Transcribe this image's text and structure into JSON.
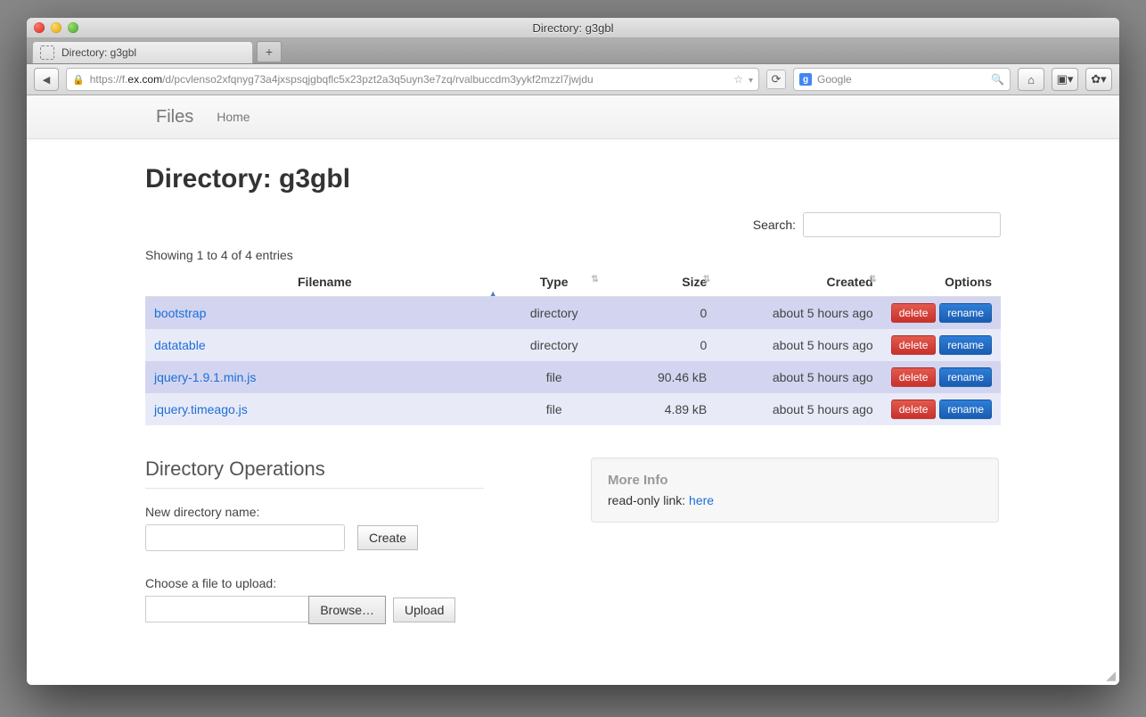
{
  "window": {
    "title": "Directory: g3gbl"
  },
  "tab": {
    "title": "Directory: g3gbl"
  },
  "url": {
    "scheme": "https://f.",
    "host": "ex.com",
    "path": "/d/pcvlenso2xfqnyg73a4jxspsqjgbqflc5x23pzt2a3q5uyn3e7zq/rvalbuccdm3yykf2mzzl7jwjdu"
  },
  "browser_search": {
    "engine_initial": "g",
    "placeholder": "Google"
  },
  "navbar": {
    "brand": "Files",
    "home": "Home"
  },
  "page_title": "Directory: g3gbl",
  "search": {
    "label": "Search:"
  },
  "entries_info": "Showing 1 to 4 of 4 entries",
  "columns": {
    "filename": "Filename",
    "type": "Type",
    "size": "Size",
    "created": "Created",
    "options": "Options"
  },
  "rows": [
    {
      "filename": "bootstrap",
      "type": "directory",
      "size": "0",
      "created": "about 5 hours ago"
    },
    {
      "filename": "datatable",
      "type": "directory",
      "size": "0",
      "created": "about 5 hours ago"
    },
    {
      "filename": "jquery-1.9.1.min.js",
      "type": "file",
      "size": "90.46 kB",
      "created": "about 5 hours ago"
    },
    {
      "filename": "jquery.timeago.js",
      "type": "file",
      "size": "4.89 kB",
      "created": "about 5 hours ago"
    }
  ],
  "buttons": {
    "delete": "delete",
    "rename": "rename",
    "create": "Create",
    "browse": "Browse…",
    "upload": "Upload"
  },
  "ops": {
    "heading": "Directory Operations",
    "new_dir_label": "New directory name:",
    "upload_label": "Choose a file to upload:"
  },
  "more_info": {
    "heading": "More Info",
    "prefix": "read-only link: ",
    "link_text": "here"
  }
}
